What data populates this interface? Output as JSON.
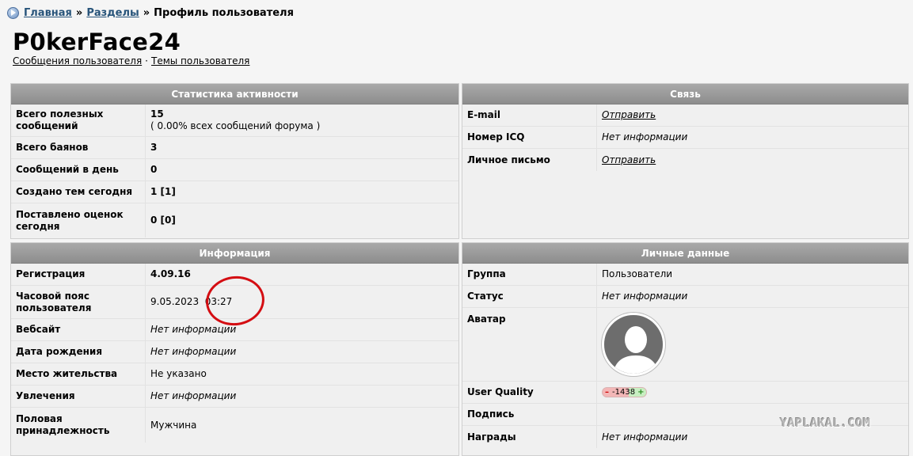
{
  "breadcrumb": {
    "home": "Главная",
    "sep1": "»",
    "sections": "Разделы",
    "sep2": "»",
    "current": "Профиль пользователя"
  },
  "profile": {
    "username": "P0kerFace24",
    "link_posts": "Сообщения пользователя",
    "link_dot": "·",
    "link_topics": "Темы пользователя"
  },
  "stats": {
    "title": "Статистика активности",
    "rows": [
      {
        "label": "Всего полезных сообщений",
        "value": "15",
        "sub": "( 0.00% всех сообщений форума )"
      },
      {
        "label": "Всего баянов",
        "value": "3"
      },
      {
        "label": "Сообщений в день",
        "value": "0"
      },
      {
        "label": "Создано тем сегодня",
        "value": "1 [1]"
      },
      {
        "label": "Поставлено оценок сегодня",
        "value": "0 [0]"
      }
    ]
  },
  "contact": {
    "title": "Связь",
    "rows": [
      {
        "label": "E-mail",
        "value": "Отправить"
      },
      {
        "label": "Номер ICQ",
        "value": "Нет информации"
      },
      {
        "label": "Личное письмо",
        "value": "Отправить"
      }
    ]
  },
  "info": {
    "title": "Информация",
    "rows": [
      {
        "label": "Регистрация",
        "value": "4.09.16"
      },
      {
        "label": "Часовой пояс пользователя",
        "date": "9.05.2023",
        "time": "03:27"
      },
      {
        "label": "Вебсайт",
        "value": "Нет информации"
      },
      {
        "label": "Дата рождения",
        "value": "Нет информации"
      },
      {
        "label": "Место жительства",
        "value": "Не указано"
      },
      {
        "label": "Увлечения",
        "value": "Нет информации"
      },
      {
        "label": "Половая принадлежность",
        "value": "Мужчина"
      }
    ]
  },
  "personal": {
    "title": "Личные данные",
    "rows": [
      {
        "label": "Группа",
        "value": "Пользователи"
      },
      {
        "label": "Статус",
        "value": "Нет информации"
      },
      {
        "label": "Аватар"
      },
      {
        "label": "User Quality",
        "minus": "–",
        "value": "-1438",
        "plus": "+"
      },
      {
        "label": "Подпись",
        "value": ""
      },
      {
        "label": "Награды",
        "value": "Нет информации"
      }
    ]
  },
  "watermark": "YAPLAKAL.COM",
  "colors": {
    "link": "#28547a",
    "header_bg": "#999999",
    "highlight_circle": "#d40d12"
  }
}
